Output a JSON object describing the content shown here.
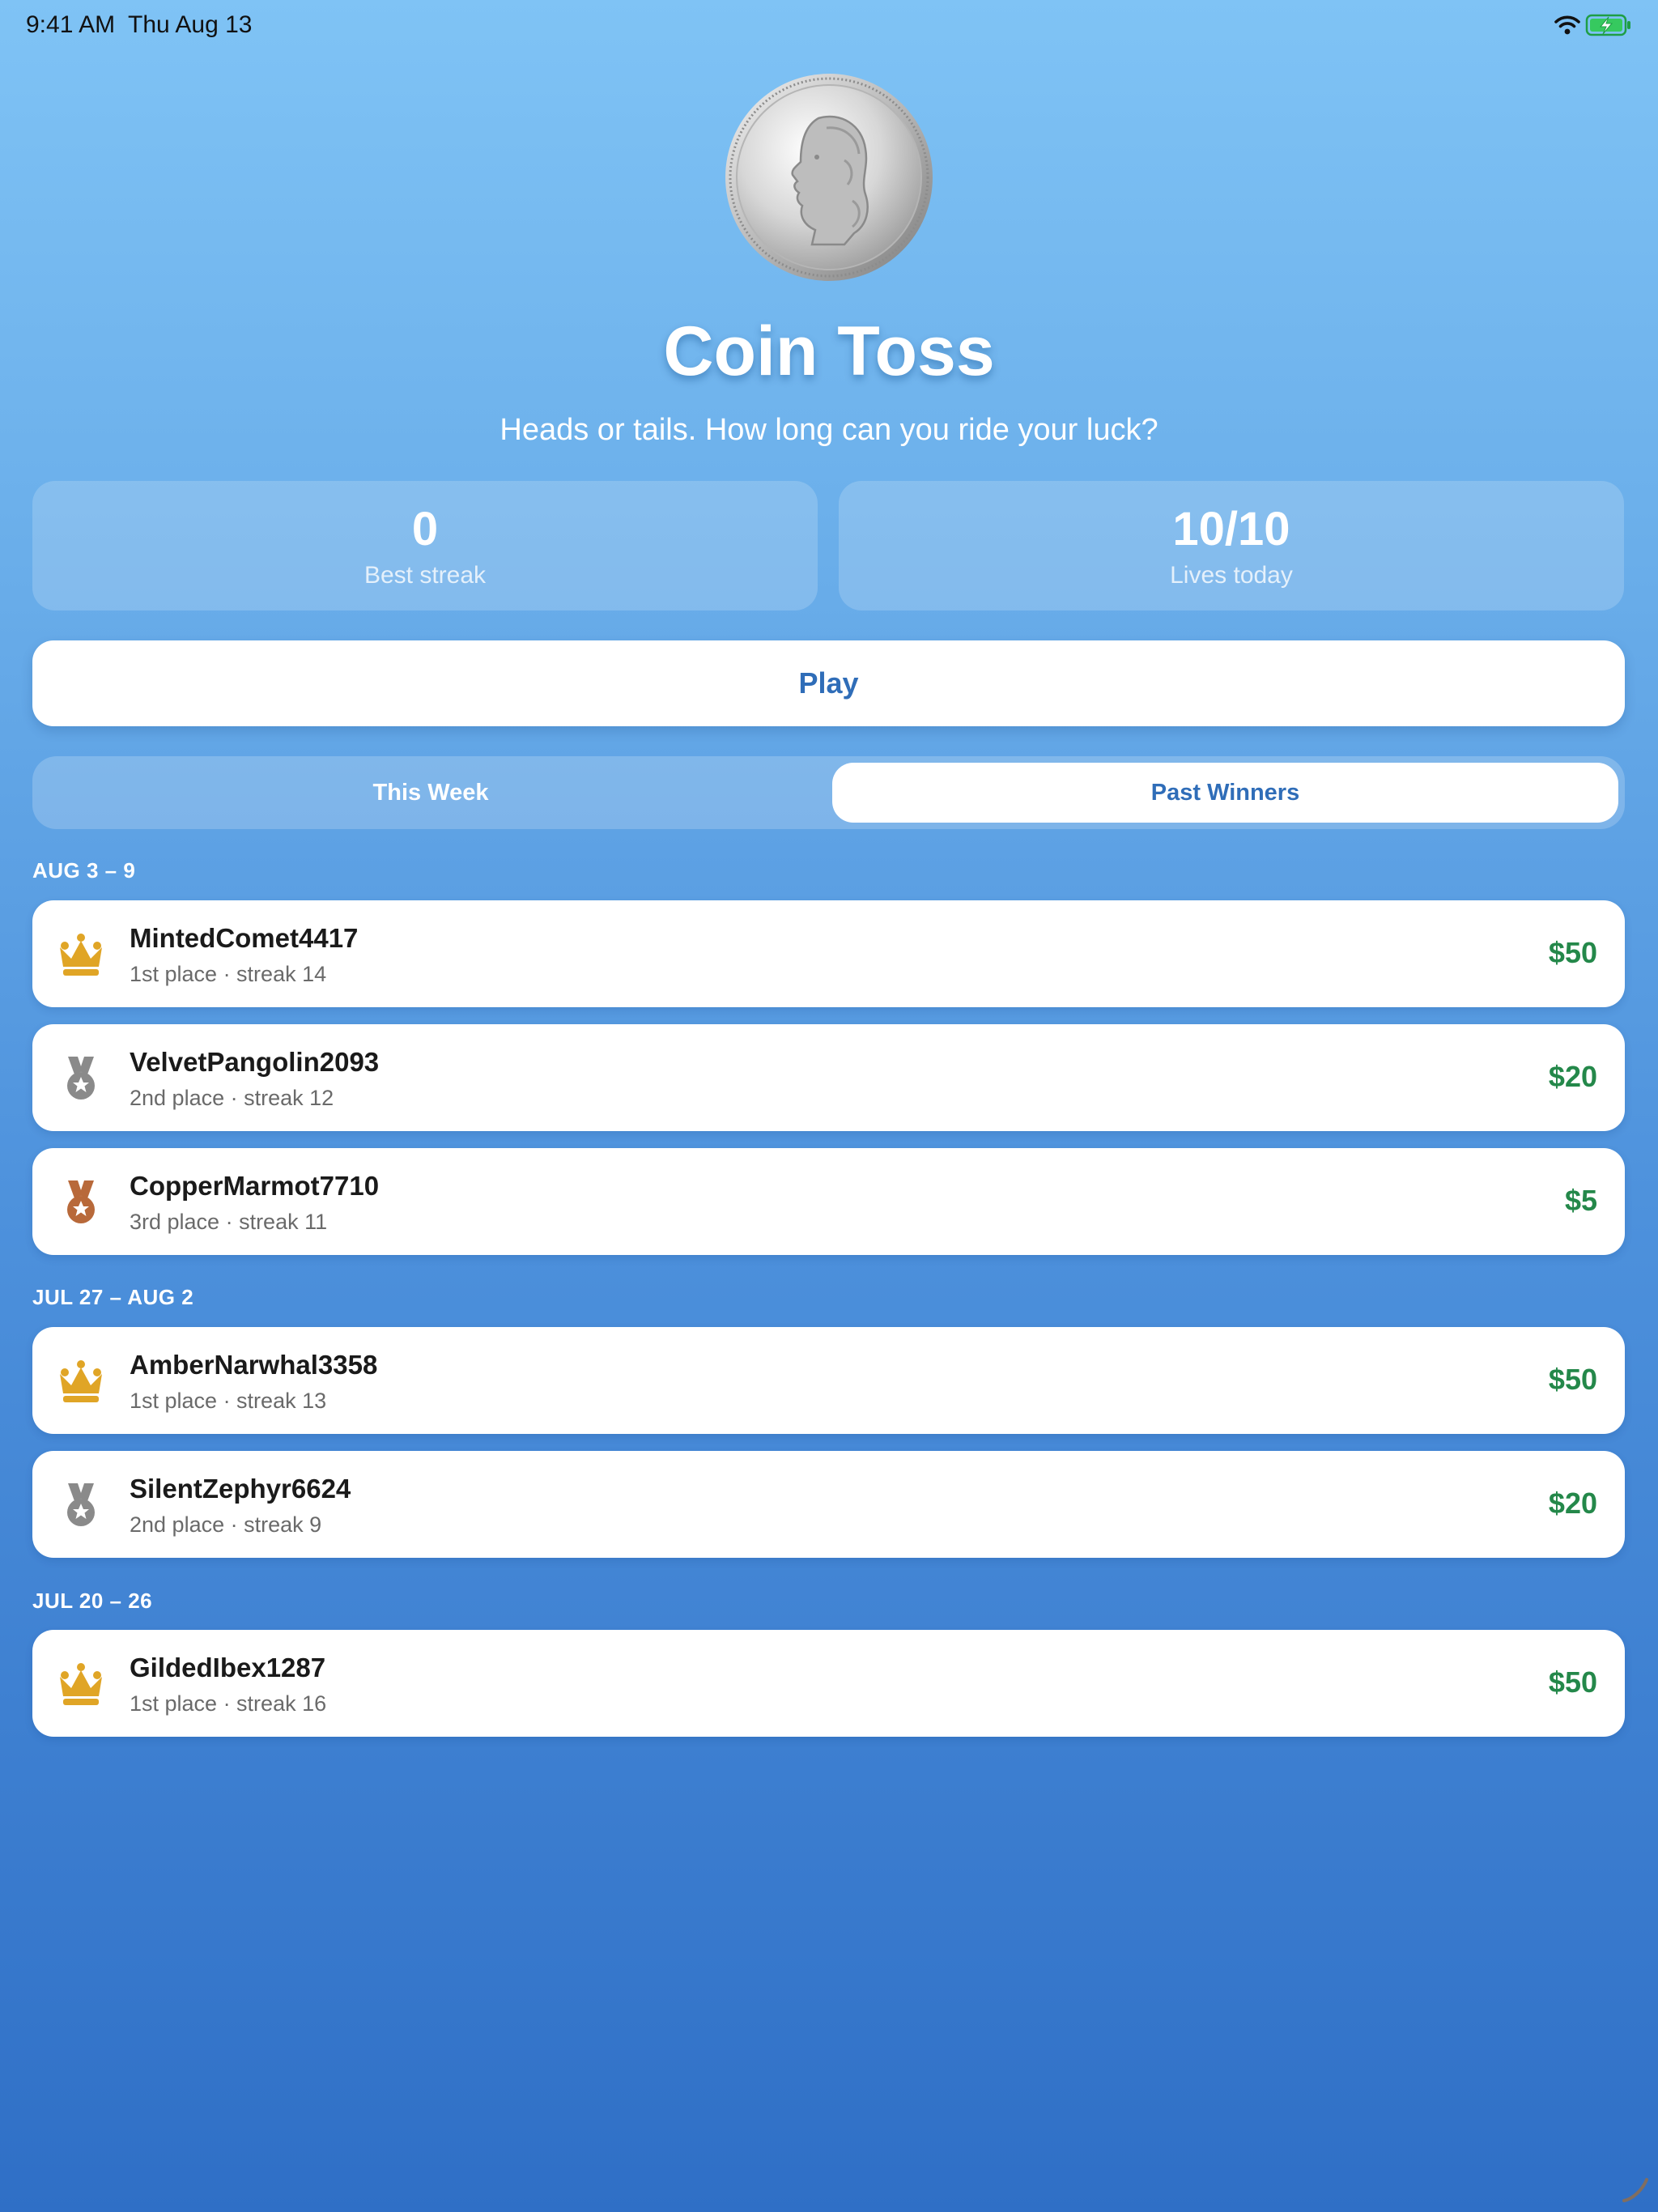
{
  "status_bar": {
    "time": "9:41 AM",
    "date": "Thu Aug 13",
    "wifi_icon": "wifi-icon",
    "battery_icon": "battery-charging-icon"
  },
  "header": {
    "coin_icon": "quarter-coin-icon",
    "title": "Coin Toss",
    "subtitle": "Heads or tails. How long can you ride your luck?"
  },
  "stats": [
    {
      "value": "0",
      "label": "Best streak"
    },
    {
      "value": "10/10",
      "label": "Lives today"
    }
  ],
  "play_label": "Play",
  "tabs": {
    "this_week": "This Week",
    "past_winners": "Past Winners",
    "selected": "Past Winners"
  },
  "weeks": [
    {
      "label": "AUG 3 – 9",
      "winners": [
        {
          "name": "MintedComet4417",
          "detail": "1st place · streak 14",
          "prize": "$50",
          "icon": "crown-icon"
        },
        {
          "name": "VelvetPangolin2093",
          "detail": "2nd place · streak 12",
          "prize": "$20",
          "icon": "silver-medal-icon"
        },
        {
          "name": "CopperMarmot7710",
          "detail": "3rd place · streak 11",
          "prize": "$5",
          "icon": "bronze-medal-icon"
        }
      ]
    },
    {
      "label": "JUL 27 – AUG 2",
      "winners": [
        {
          "name": "AmberNarwhal3358",
          "detail": "1st place · streak 13",
          "prize": "$50",
          "icon": "crown-icon"
        },
        {
          "name": "SilentZephyr6624",
          "detail": "2nd place · streak 9",
          "prize": "$20",
          "icon": "silver-medal-icon"
        }
      ]
    },
    {
      "label": "JUL 20 – 26",
      "winners": [
        {
          "name": "GildedIbex1287",
          "detail": "1st place · streak 16",
          "prize": "$50",
          "icon": "crown-icon"
        }
      ]
    }
  ],
  "colors": {
    "accent_blue": "#2f6db8",
    "prize_green": "#24884a",
    "gold": "#e0a526",
    "silver": "#8a8a8a",
    "bronze": "#b8693a"
  }
}
